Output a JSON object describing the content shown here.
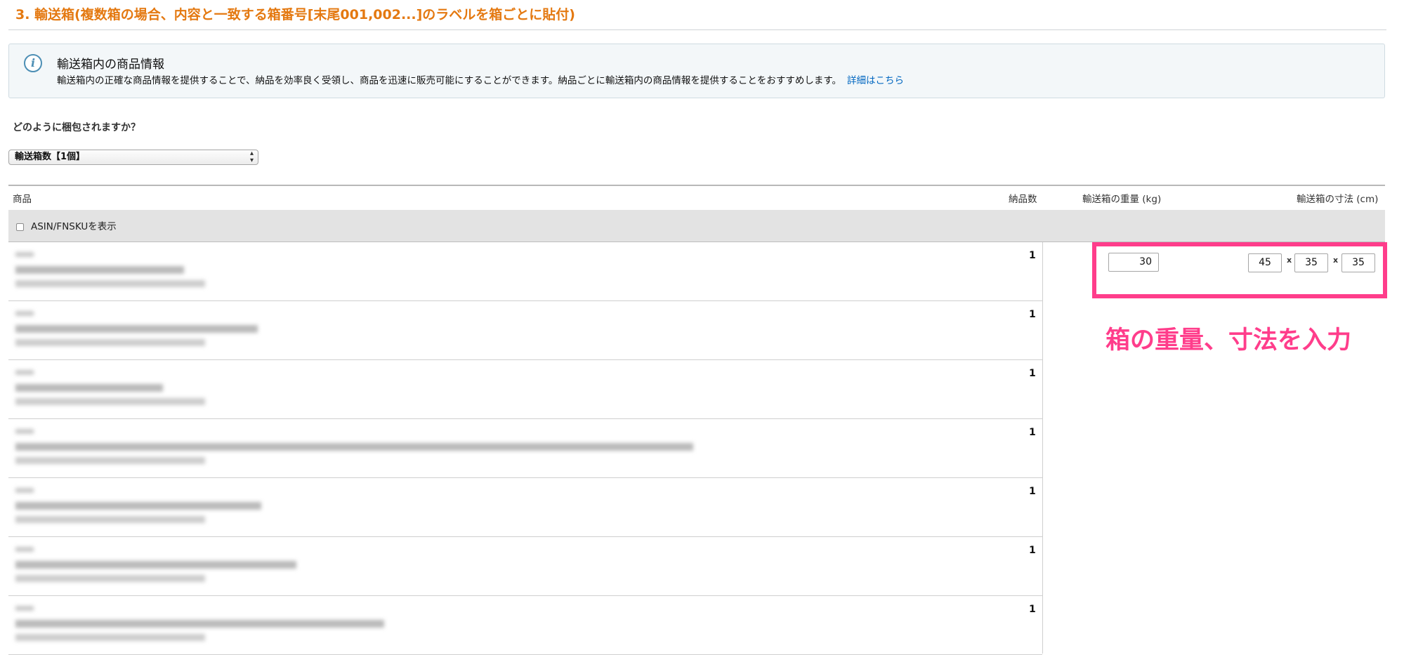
{
  "section": {
    "title": "3. 輸送箱(複数箱の場合、内容と一致する箱番号[末尾001,002...]のラベルを箱ごとに貼付)"
  },
  "info": {
    "icon": "info-icon",
    "icon_glyph": "i",
    "heading": "輸送箱内の商品情報",
    "body": "輸送箱内の正確な商品情報を提供することで、納品を効率良く受領し、商品を迅速に販売可能にすることができます。納品ごとに輸送箱内の商品情報を提供することをおすすめします。",
    "link": "詳細はこちら"
  },
  "packing": {
    "question": "どのように梱包されますか？",
    "selected_option": "輸送箱数【1個】"
  },
  "table": {
    "headers": {
      "product": "商品",
      "quantity": "納品数",
      "weight": "輸送箱の重量 (kg)",
      "dimensions": "輸送箱の寸法 (cm)"
    },
    "show_asin_label": "ASIN/FNSKUを表示",
    "show_asin_checked": false,
    "rows": [
      {
        "quantity": "1"
      },
      {
        "quantity": "1"
      },
      {
        "quantity": "1"
      },
      {
        "quantity": "1"
      },
      {
        "quantity": "1"
      },
      {
        "quantity": "1"
      },
      {
        "quantity": "1"
      }
    ]
  },
  "box": {
    "weight": "30",
    "length": "45",
    "width": "35",
    "height": "35",
    "times_symbol": "x"
  },
  "annotation": {
    "text": "箱の重量、寸法を入力",
    "color": "#ff3d8b"
  },
  "colors": {
    "title": "#e47911",
    "link": "#0066c0",
    "highlight": "#ff3d8b"
  }
}
